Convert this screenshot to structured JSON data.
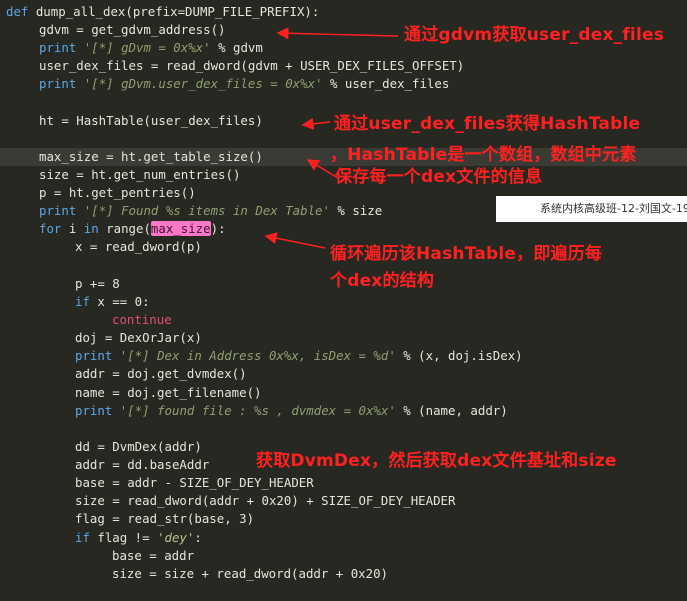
{
  "code": {
    "l1_def": "def",
    "l1_rest": " dump_all_dex(prefix=DUMP_FILE_PREFIX):",
    "l2": "gdvm = get_gdvm_address()",
    "l3_print": "print",
    "l3_str": "'[*] gDvm = 0x%x'",
    "l3_rest": " % gdvm",
    "l4": "user_dex_files = read_dword(gdvm + USER_DEX_FILES_OFFSET)",
    "l5_print": "print",
    "l5_str": "'[*] gDvm.user_dex_files = 0x%x'",
    "l5_rest": " % user_dex_files",
    "l6": "ht = HashTable(user_dex_files)",
    "l7": "max_size = ht.get_table_size()",
    "l8": "size = ht.get_num_entries()",
    "l9": "p = ht.get_pentries()",
    "l10_print": "print",
    "l10_str": "'[*] Found %s items in Dex Table'",
    "l10_rest": " % size",
    "l11_for": "for",
    "l11_a": " i ",
    "l11_in": "in",
    "l11_b": " range(",
    "l11_sel": "max_size",
    "l11_c": "):",
    "l12": "x = read_dword(p)",
    "l13": "p += 8",
    "l14_if": "if",
    "l14_rest": " x == 0:",
    "l15": "continue",
    "l16": "doj = DexOrJar(x)",
    "l17_print": "print",
    "l17_str": "'[*] Dex in Address 0x%x, isDex = %d'",
    "l17_rest": " % (x, doj.isDex)",
    "l18": "addr = doj.get_dvmdex()",
    "l19": "name = doj.get_filename()",
    "l20_print": "print",
    "l20_str": "'[*] found file : %s , dvmdex = 0x%x'",
    "l20_rest": " % (name, addr)",
    "l21": "dd = DvmDex(addr)",
    "l22": "addr = dd.baseAddr",
    "l23": "base = addr - SIZE_OF_DEY_HEADER",
    "l24": "size = read_dword(addr + 0x20) + SIZE_OF_DEY_HEADER",
    "l25": "flag = read_str(base, 3)",
    "l26_if": "if",
    "l26_a": " flag != ",
    "l26_str": "'dey'",
    "l26_b": ":",
    "l27": "base = addr",
    "l28": "size = size + read_dword(addr + 0x20)"
  },
  "annotations": {
    "a1": "通过gdvm获取user_dex_files",
    "a2": "通过user_dex_files获得HashTable",
    "a3": "，HashTable是一个数组，数组中元素",
    "a4": "保存每一个dex文件的信息",
    "a5": "循环遍历该HashTable，即遍历每",
    "a6": "个dex的结构",
    "a7": "获取DvmDex，然后获取dex文件基址和size"
  },
  "watermark": "系统内核高级班-12-刘国文-19",
  "colors": {
    "background": "#272822",
    "annotation": "#ff2020",
    "keyword": "#5aa8e8",
    "selection": "#ff77c8"
  }
}
